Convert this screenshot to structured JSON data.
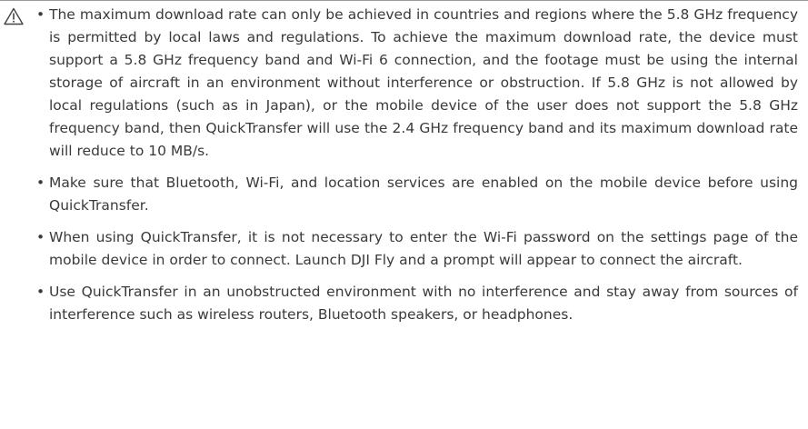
{
  "notices": [
    "The maximum download rate can only be achieved in countries and regions where the 5.8 GHz frequency is permitted by local laws and regulations. To achieve the maximum download rate, the device must support a 5.8 GHz frequency band and Wi-Fi 6 connection, and the footage must be using the internal storage of aircraft in an environment without interference or obstruction. If 5.8 GHz is not allowed by local regulations (such as in Japan), or the mobile device of the user does not support the 5.8 GHz frequency band, then QuickTransfer will use the 2.4 GHz frequency band and its maximum download rate will reduce to 10 MB/s.",
    "Make sure that Bluetooth, Wi-Fi, and location services are enabled on the mobile device before using QuickTransfer.",
    "When using QuickTransfer, it is not necessary to enter the Wi-Fi password on the settings page of the mobile device in order to connect. Launch DJI Fly and a prompt will appear to connect the aircraft.",
    "Use QuickTransfer in an unobstructed environment with no interference and stay away from sources of interference such as wireless routers, Bluetooth speakers, or headphones."
  ],
  "icon": "warning-triangle-icon",
  "colors": {
    "text": "#3a3a3a",
    "rule": "#9a9a9a",
    "icon": "#444444"
  }
}
